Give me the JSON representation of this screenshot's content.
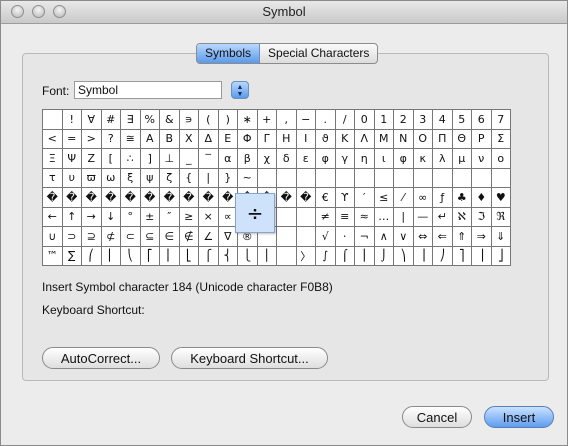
{
  "window": {
    "title": "Symbol"
  },
  "tabs": [
    {
      "label": "Symbols",
      "active": true
    },
    {
      "label": "Special Characters",
      "active": false
    }
  ],
  "font": {
    "label": "Font:",
    "value": "Symbol"
  },
  "grid_rows": [
    [
      "",
      "!",
      "∀",
      "#",
      "∃",
      "%",
      "&",
      "∍",
      "(",
      ")",
      "∗",
      "+",
      ",",
      "−",
      ".",
      "/",
      "0",
      "1",
      "2",
      "3",
      "4",
      "5",
      "6",
      "7",
      "8",
      "9",
      ":",
      ";"
    ],
    [
      "<",
      "=",
      ">",
      "?",
      "≅",
      "Α",
      "Β",
      "Χ",
      "Δ",
      "Ε",
      "Φ",
      "Γ",
      "Η",
      "Ι",
      "ϑ",
      "Κ",
      "Λ",
      "Μ",
      "Ν",
      "Ο",
      "Π",
      "Θ",
      "Ρ",
      "Σ",
      "Τ",
      "Υ",
      "ς",
      "Ω"
    ],
    [
      "Ξ",
      "Ψ",
      "Ζ",
      "[",
      "∴",
      "]",
      "⊥",
      "_",
      "‾",
      "α",
      "β",
      "χ",
      "δ",
      "ε",
      "φ",
      "γ",
      "η",
      "ι",
      "φ",
      "κ",
      "λ",
      "μ",
      "ν",
      "ο",
      "π",
      "θ",
      "ρ",
      "σ"
    ],
    [
      "τ",
      "υ",
      "ϖ",
      "ω",
      "ξ",
      "ψ",
      "ζ",
      "{",
      "|",
      "}",
      "~",
      "",
      "",
      "",
      "",
      "",
      "",
      "",
      "",
      "",
      "",
      "",
      "",
      "",
      "",
      "",
      "",
      ""
    ],
    [
      "�",
      "�",
      "�",
      "�",
      "�",
      "�",
      "�",
      "�",
      "�",
      "�",
      "�",
      "�",
      "�",
      "�",
      "€",
      "ϒ",
      "′",
      "≤",
      "⁄",
      "∞",
      "ƒ",
      "♣",
      "♦",
      "♥",
      "♠",
      "↔",
      "",
      ""
    ],
    [
      "←",
      "↑",
      "→",
      "↓",
      "°",
      "±",
      "″",
      "≥",
      "×",
      "∝",
      "∂",
      "",
      "",
      "",
      "≠",
      "≡",
      "≈",
      "…",
      "|",
      "—",
      "↵",
      "ℵ",
      "ℑ",
      "ℜ",
      "℘",
      "⊗",
      "⊕",
      "∅",
      "∩"
    ],
    [
      "∪",
      "⊃",
      "⊇",
      "⊄",
      "⊂",
      "⊆",
      "∈",
      "∉",
      "∠",
      "∇",
      "®",
      "",
      "",
      "",
      "√",
      "⋅",
      "¬",
      "∧",
      "∨",
      "⇔",
      "⇐",
      "⇑",
      "⇒",
      "⇓",
      "◊",
      "〈",
      "®",
      "©"
    ],
    [
      "™",
      "∑",
      "⎛",
      "⎜",
      "⎝",
      "⎡",
      "⎢",
      "⎣",
      "⎧",
      "⎨",
      "⎩",
      "⎪",
      "",
      "〉",
      "∫",
      "⌠",
      "⎮",
      "⌡",
      "⎞",
      "⎟",
      "⎠",
      "⎤",
      "⎥",
      "⎦",
      "⎫",
      "⎬",
      "⎭",
      "�"
    ]
  ],
  "magnified_char": "÷",
  "info_text": "Insert Symbol character 184  (Unicode character F0B8)",
  "keyboard_shortcut_label": "Keyboard Shortcut:",
  "buttons": {
    "autocorrect": "AutoCorrect...",
    "keyboard_shortcut": "Keyboard Shortcut...",
    "cancel": "Cancel",
    "insert": "Insert"
  },
  "icons": {
    "close": "close-icon",
    "minimize": "minimize-icon",
    "zoom": "zoom-icon",
    "font_stepper": "up-down-arrows-icon"
  },
  "colors": {
    "accent_blue": "#5f9cf0",
    "magnifier_bg": "#cfe2fb"
  }
}
